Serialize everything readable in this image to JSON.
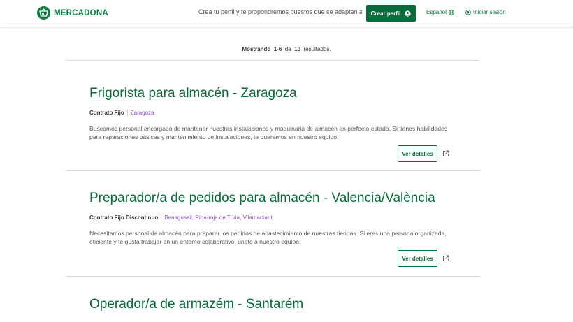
{
  "header": {
    "brand": "MERCADONA",
    "promo": "Crea tu perfil y te propondremos puestos que se adapten a ti",
    "create_profile": "Crear perfil",
    "language": "Español",
    "login": "Iniciar sesión",
    "accent_color": "#0a6b3a"
  },
  "results": {
    "prefix": "Mostrando",
    "range": "1-6",
    "of": "de",
    "total": "10",
    "suffix": "resultados."
  },
  "jobs": [
    {
      "title": "Frigorista para almacén - Zaragoza",
      "contract": "Contrato Fijo",
      "location": "Zaragoza",
      "description": "Buscamos personal encargado de mantener nuestras instalaciones y maquinaria de almacén en perfecto estado. Si tienes habilidades para reparaciones básicas y mantenimiento de instalaciones, te queremos en nuestro equipo.",
      "details_label": "Ver detalles"
    },
    {
      "title": "Preparador/a de pedidos para almacén - Valencia/València",
      "contract": "Contrato Fijo Discontinuo",
      "location": "Benaguasil, Riba-roja de Túria, Vilamarxant",
      "description": "Necesitamos personal de almacén para preparar los pedidos de abastecimiento de nuestras tiendas. Si eres una persona organizada, eficiente y te gusta trabajar en un entorno colaborativo, únete a nuestro equipo.",
      "details_label": "Ver detalles"
    },
    {
      "title": "Operador/a de armazém - Santarém"
    }
  ]
}
